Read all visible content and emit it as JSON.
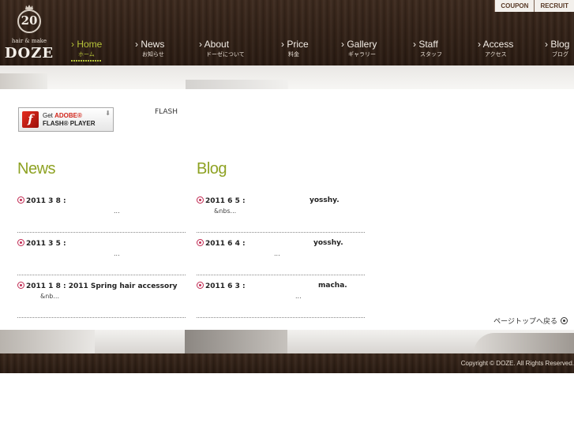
{
  "logo": {
    "number": "20",
    "sub": "hair & make",
    "brand": "DOZE"
  },
  "top_buttons": [
    "COUPON",
    "RECRUIT"
  ],
  "nav": [
    {
      "en": "Home",
      "jp": "ホーム",
      "active": true
    },
    {
      "en": "News",
      "jp": "お知らせ"
    },
    {
      "en": "About",
      "jp": "ドーゼについて"
    },
    {
      "en": "Price",
      "jp": "料金"
    },
    {
      "en": "Gallery",
      "jp": "ギャラリー"
    },
    {
      "en": "Staff",
      "jp": "スタッフ"
    },
    {
      "en": "Access",
      "jp": "アクセス"
    },
    {
      "en": "Blog",
      "jp": "ブログ"
    }
  ],
  "flash": {
    "badge_get": "Get ",
    "badge_adobe": "ADOBE®",
    "badge_player": "FLASH® PLAYER",
    "text": "FLASH"
  },
  "news": {
    "title": "News",
    "entries": [
      {
        "line1": "2011 3 8 :",
        "line2": "..."
      },
      {
        "line1": "2011 3 5 :",
        "line2": "..."
      },
      {
        "line1": "2011 1 8 : 2011 Spring hair accessory",
        "line2": "&nb..."
      }
    ]
  },
  "blog": {
    "title": "Blog",
    "entries": [
      {
        "line1": "2011 6 5 :",
        "author": "yosshy.",
        "line2": "&nbs..."
      },
      {
        "line1": "2011 6 4 :",
        "author": "yosshy.",
        "line2": "..."
      },
      {
        "line1": "2011 6 3 :",
        "author": "macha.",
        "line2": "..."
      }
    ]
  },
  "page_top": "ページトップへ戻る",
  "footer": {
    "copyright": "Copyright © DOZE. All Rights Reserved."
  }
}
